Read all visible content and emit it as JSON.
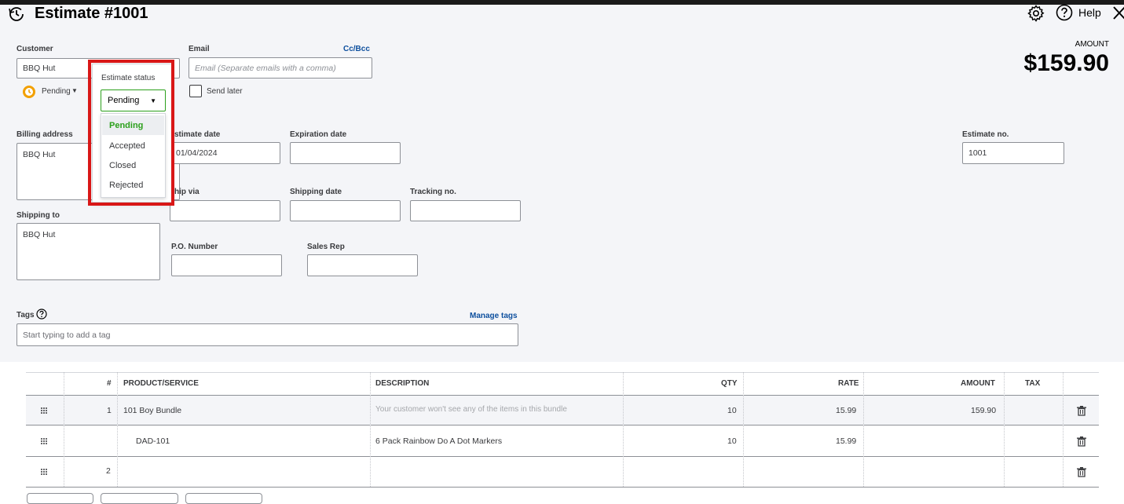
{
  "header": {
    "title": "Estimate #1001",
    "help_label": "Help",
    "amount_label": "AMOUNT",
    "amount_value": "$159.90"
  },
  "customer": {
    "label": "Customer",
    "value": "BBQ Hut",
    "status_text": "Pending"
  },
  "email": {
    "label": "Email",
    "cc_bcc": "Cc/Bcc",
    "placeholder": "Email (Separate emails with a comma)",
    "send_later": "Send later"
  },
  "status_popup": {
    "title": "Estimate status",
    "selected": "Pending",
    "options": [
      "Pending",
      "Accepted",
      "Closed",
      "Rejected"
    ]
  },
  "billing": {
    "label": "Billing address",
    "value": "BBQ Hut"
  },
  "shipping_to": {
    "label": "Shipping to",
    "value": "BBQ Hut"
  },
  "dates": {
    "estimate_date_label": "stimate date",
    "estimate_date_value": "01/04/2024",
    "expiration_label": "Expiration date",
    "expiration_value": "",
    "estimate_no_label": "Estimate no.",
    "estimate_no_value": "1001"
  },
  "shipping": {
    "ship_via_label": "hip via",
    "ship_via_value": "",
    "shipping_date_label": "Shipping date",
    "shipping_date_value": "",
    "tracking_label": "Tracking no.",
    "tracking_value": ""
  },
  "po": {
    "po_label": "P.O. Number",
    "po_value": "",
    "sales_rep_label": "Sales Rep",
    "sales_rep_value": ""
  },
  "tags": {
    "label": "Tags",
    "manage": "Manage tags",
    "placeholder": "Start typing to add a tag"
  },
  "table": {
    "headers": {
      "num": "#",
      "product": "PRODUCT/SERVICE",
      "description": "DESCRIPTION",
      "qty": "QTY",
      "rate": "RATE",
      "amount": "AMOUNT",
      "tax": "TAX"
    },
    "rows": [
      {
        "num": "1",
        "product": "101 Boy Bundle",
        "description": "Your customer won't see any of the items in this bundle",
        "qty": "10",
        "rate": "15.99",
        "amount": "159.90"
      },
      {
        "num": "",
        "product": "DAD-101",
        "description": "6 Pack Rainbow Do A Dot Markers",
        "qty": "10",
        "rate": "15.99",
        "amount": ""
      },
      {
        "num": "2",
        "product": "",
        "description": "",
        "qty": "",
        "rate": "",
        "amount": ""
      }
    ]
  },
  "colors": {
    "accent_green": "#2ca01c",
    "highlight_red": "#d91717",
    "link_blue": "#0d4f9e",
    "pending_orange": "#f2a000"
  }
}
